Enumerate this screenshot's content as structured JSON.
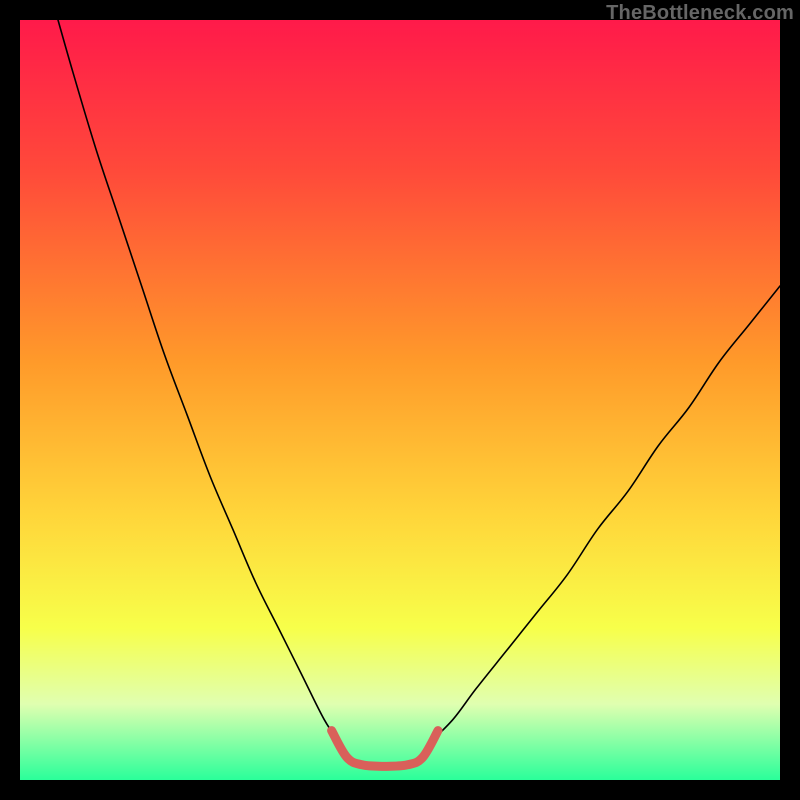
{
  "watermark": "TheBottleneck.com",
  "chart_data": {
    "type": "line",
    "title": "",
    "xlabel": "",
    "ylabel": "",
    "xlim": [
      0,
      100
    ],
    "ylim": [
      0,
      100
    ],
    "grid": false,
    "legend": false,
    "background_gradient": {
      "stops": [
        {
          "offset": 0.0,
          "color": "#ff1a4a"
        },
        {
          "offset": 0.2,
          "color": "#ff4a3a"
        },
        {
          "offset": 0.45,
          "color": "#ff9a2a"
        },
        {
          "offset": 0.65,
          "color": "#ffd53a"
        },
        {
          "offset": 0.8,
          "color": "#f7ff4a"
        },
        {
          "offset": 0.9,
          "color": "#e0ffb0"
        },
        {
          "offset": 1.0,
          "color": "#2aff9a"
        }
      ]
    },
    "series": [
      {
        "name": "curve-left",
        "stroke": "#000000",
        "x": [
          5,
          7,
          10,
          13,
          16,
          19,
          22,
          25,
          28,
          31,
          34,
          37,
          40,
          42
        ],
        "y": [
          100,
          93,
          83,
          74,
          65,
          56,
          48,
          40,
          33,
          26,
          20,
          14,
          8,
          5
        ]
      },
      {
        "name": "curve-right",
        "stroke": "#000000",
        "x": [
          54,
          57,
          60,
          64,
          68,
          72,
          76,
          80,
          84,
          88,
          92,
          96,
          100
        ],
        "y": [
          5,
          8,
          12,
          17,
          22,
          27,
          33,
          38,
          44,
          49,
          55,
          60,
          65
        ]
      },
      {
        "name": "highlight-bottom",
        "stroke": "#d9605a",
        "stroke_width": 9,
        "x": [
          41,
          43,
          45,
          48,
          51,
          53,
          55
        ],
        "y": [
          6.5,
          3.0,
          2.0,
          1.8,
          2.0,
          3.0,
          6.5
        ]
      }
    ]
  }
}
